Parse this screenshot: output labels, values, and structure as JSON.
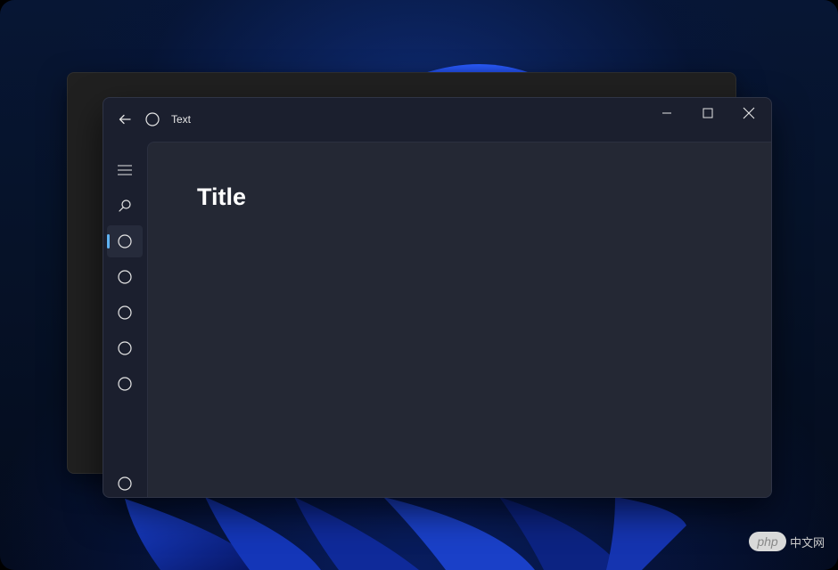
{
  "window": {
    "title": "Text",
    "page_title": "Title"
  },
  "nav": {
    "items": [
      {
        "icon": "hamburger-icon"
      },
      {
        "icon": "search-icon"
      },
      {
        "icon": "circle-icon",
        "selected": true
      },
      {
        "icon": "circle-icon"
      },
      {
        "icon": "circle-icon"
      },
      {
        "icon": "circle-icon"
      },
      {
        "icon": "circle-icon"
      },
      {
        "icon": "circle-icon"
      }
    ]
  },
  "colors": {
    "accent": "#5fb2f2",
    "window_bg": "#1b1f2e",
    "content_bg": "#242834",
    "back_window_bg": "#202020"
  },
  "watermark": {
    "logo_text": "php",
    "text": "中文网"
  }
}
